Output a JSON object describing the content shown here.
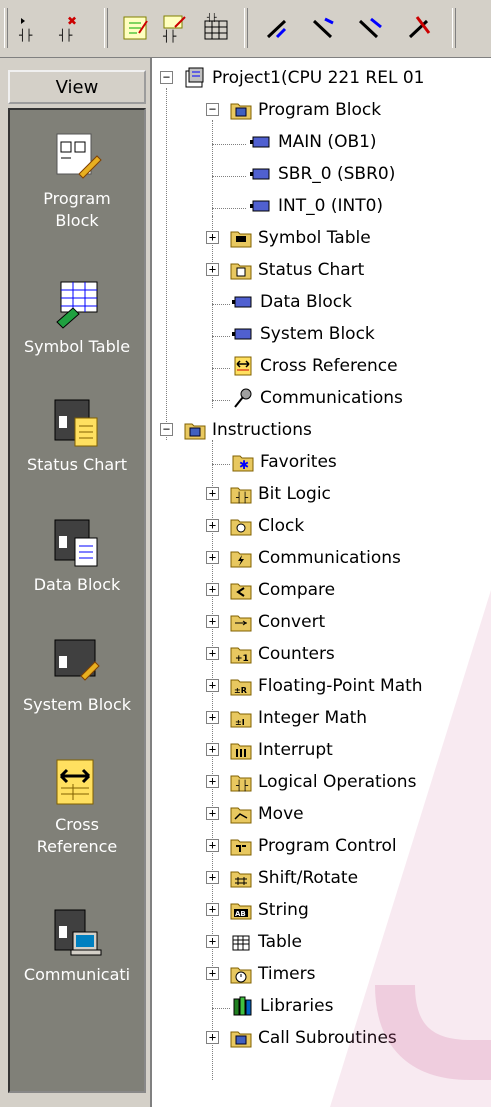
{
  "toolbar": {
    "buttons": [
      {
        "name": "insert-network-icon"
      },
      {
        "name": "delete-network-icon"
      },
      {
        "name": "program-block-edit-icon"
      },
      {
        "name": "network-edit-icon"
      },
      {
        "name": "table-icon"
      },
      {
        "name": "line-arrow-up-icon"
      },
      {
        "name": "line-arrow-down-icon"
      },
      {
        "name": "line-arrow-right-icon"
      },
      {
        "name": "line-delete-icon"
      }
    ]
  },
  "sidebar": {
    "view_label": "View",
    "items": [
      {
        "label": "Program\nBlock",
        "icon": "program-block-icon"
      },
      {
        "label": "Symbol Table",
        "icon": "symbol-table-icon"
      },
      {
        "label": "Status Chart",
        "icon": "status-chart-icon"
      },
      {
        "label": "Data Block",
        "icon": "data-block-icon"
      },
      {
        "label": "System Block",
        "icon": "system-block-icon"
      },
      {
        "label": "Cross\nReference",
        "icon": "cross-reference-icon"
      },
      {
        "label": "Communicati",
        "icon": "communications-icon"
      }
    ]
  },
  "tree": {
    "project": "Project1(CPU 221 REL 01",
    "program_block": "Program Block",
    "main": "MAIN (OB1)",
    "sbr": "SBR_0 (SBR0)",
    "int": "INT_0 (INT0)",
    "symbol_table": "Symbol Table",
    "status_chart": "Status Chart",
    "data_block": "Data Block",
    "system_block": "System Block",
    "cross_reference": "Cross Reference",
    "communications": "Communications",
    "instructions": "Instructions",
    "favorites": "Favorites",
    "bit_logic": "Bit Logic",
    "clock": "Clock",
    "communications2": "Communications",
    "compare": "Compare",
    "convert": "Convert",
    "counters": "Counters",
    "floating_point": "Floating-Point Math",
    "integer_math": "Integer Math",
    "interrupt": "Interrupt",
    "logical_ops": "Logical Operations",
    "move": "Move",
    "program_control": "Program Control",
    "shift_rotate": "Shift/Rotate",
    "string": "String",
    "table": "Table",
    "timers": "Timers",
    "libraries": "Libraries",
    "call_subroutines": "Call Subroutines"
  },
  "colors": {
    "chrome": "#d4d0c8",
    "panel": "#808078",
    "watermark": "#c8508c"
  }
}
